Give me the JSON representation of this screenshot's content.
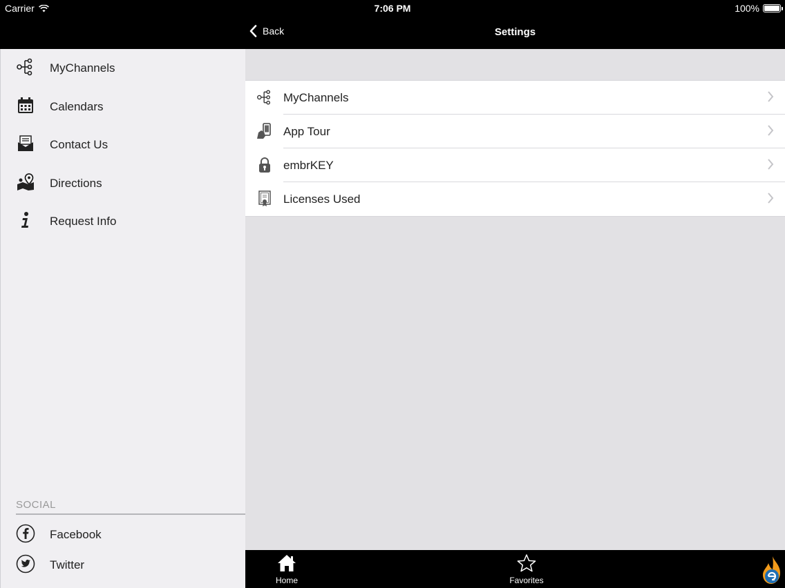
{
  "status_bar": {
    "carrier": "Carrier",
    "time": "7:06 PM",
    "battery": "100%",
    "battery_level": 1.0
  },
  "nav": {
    "back_label": "Back",
    "title": "Settings"
  },
  "sidebar": {
    "items": [
      {
        "label": "MyChannels",
        "icon": "channels-icon"
      },
      {
        "label": "Calendars",
        "icon": "calendar-icon"
      },
      {
        "label": "Contact Us",
        "icon": "envelope-icon"
      },
      {
        "label": "Directions",
        "icon": "map-pin-icon"
      },
      {
        "label": "Request Info",
        "icon": "info-icon"
      }
    ],
    "social_header": "SOCIAL",
    "social_items": [
      {
        "label": "Facebook",
        "icon": "facebook-icon"
      },
      {
        "label": "Twitter",
        "icon": "twitter-icon"
      }
    ]
  },
  "settings": {
    "rows": [
      {
        "label": "MyChannels",
        "icon": "channels-icon"
      },
      {
        "label": "App Tour",
        "icon": "phone-hand-icon"
      },
      {
        "label": "embrKEY",
        "icon": "lock-icon"
      },
      {
        "label": "Licenses Used",
        "icon": "certificate-icon"
      }
    ]
  },
  "tab_bar": {
    "tabs": [
      {
        "label": "Home",
        "icon": "home-icon"
      },
      {
        "label": "Favorites",
        "icon": "star-icon"
      }
    ],
    "brand": "embr-logo"
  },
  "colors": {
    "bar_bg": "#000000",
    "sidebar_bg": "#f0eff2",
    "content_bg": "#e2e1e4",
    "logo_blue": "#1f6fb5",
    "logo_orange": "#f29b1b"
  }
}
